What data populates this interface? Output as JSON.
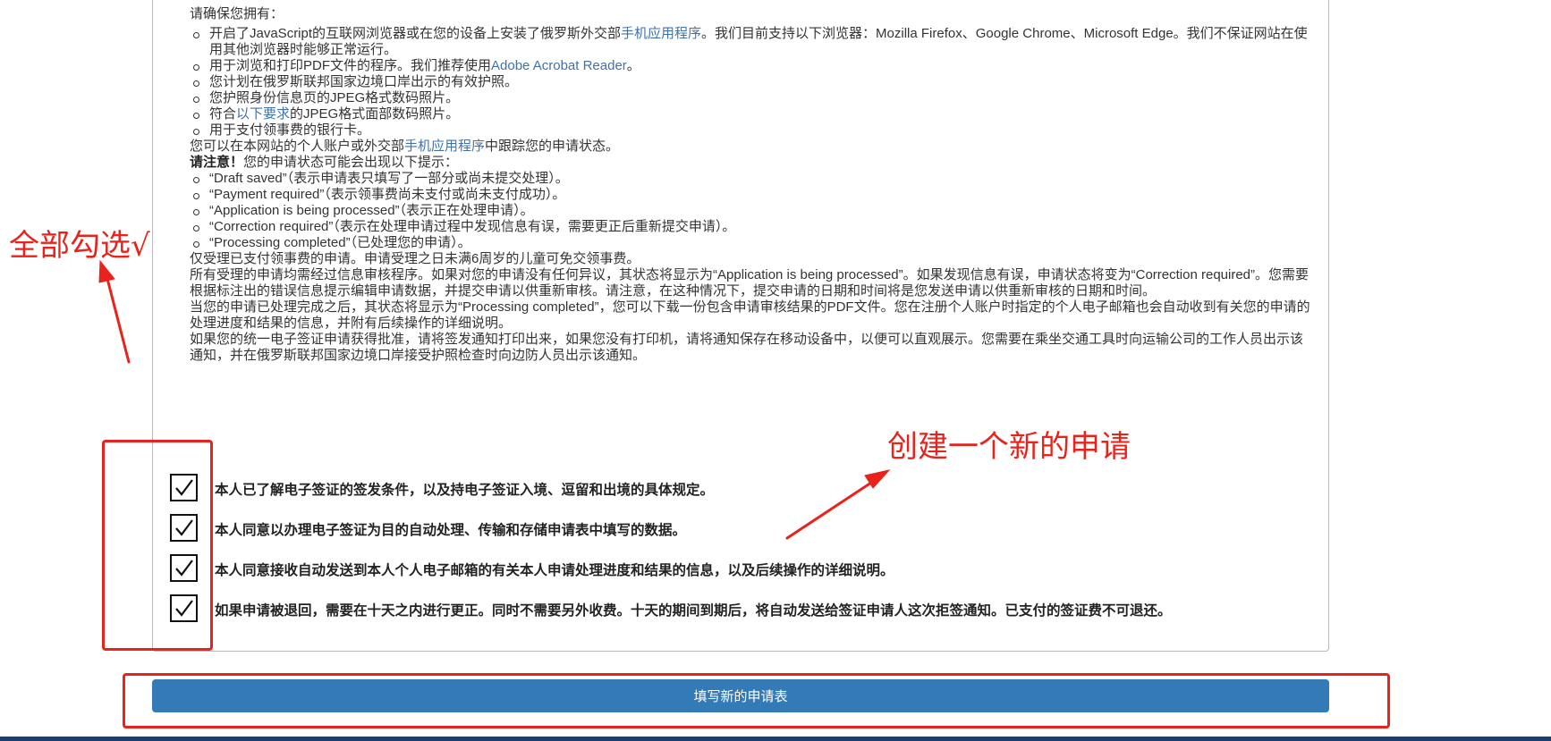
{
  "intro": {
    "heading": "请确保您拥有：",
    "bullets": [
      {
        "before": "开启了JavaScript的互联网浏览器或在您的设备上安装了俄罗斯外交部",
        "link": "手机应用程序",
        "after": "。我们目前支持以下浏览器：Mozilla Firefox、Google Chrome、Microsoft Edge。我们不保证网站在使用其他浏览器时能够正常运行。"
      },
      {
        "before": "用于浏览和打印PDF文件的程序。我们推荐使用",
        "link": "Adobe Acrobat Reader",
        "after": "。"
      },
      {
        "before": "您计划在俄罗斯联邦国家边境口岸出示的有效护照。",
        "link": "",
        "after": ""
      },
      {
        "before": "您护照身份信息页的JPEG格式数码照片。",
        "link": "",
        "after": ""
      },
      {
        "before": "符合",
        "link": "以下要求",
        "after": "的JPEG格式面部数码照片。"
      },
      {
        "before": "用于支付领事费的银行卡。",
        "link": "",
        "after": ""
      }
    ]
  },
  "tracking": {
    "before": "您可以在本网站的个人账户或外交部",
    "link": "手机应用程序",
    "after": "中跟踪您的申请状态。"
  },
  "notice": {
    "bold": "请注意！",
    "text": "您的申请状态可能会出现以下提示：",
    "statuses": [
      "“Draft saved”（表示申请表只填写了一部分或尚未提交处理）。",
      "“Payment required”（表示领事费尚未支付或尚未支付成功）。",
      "“Application is being processed”（表示正在处理申请）。",
      "“Correction required”（表示在处理申请过程中发现信息有误，需要更正后重新提交申请）。",
      "“Processing completed”（已处理您的申请）。"
    ]
  },
  "paragraphs": [
    "仅受理已支付领事费的申请。申请受理之日未满6周岁的儿童可免交领事费。",
    "所有受理的申请均需经过信息审核程序。如果对您的申请没有任何异议，其状态将显示为“Application is being processed”。如果发现信息有误，申请状态将变为“Correction required”。您需要根据标注出的错误信息提示编辑申请数据，并提交申请以供重新审核。请注意，在这种情况下，提交申请的日期和时间将是您发送申请以供重新审核的日期和时间。",
    "当您的申请已处理完成之后，其状态将显示为“Processing completed”，您可以下载一份包含申请审核结果的PDF文件。您在注册个人账户时指定的个人电子邮箱也会自动收到有关您的申请的处理进度和结果的信息，并附有后续操作的详细说明。",
    "如果您的统一电子签证申请获得批准，请将签发通知打印出来，如果您没有打印机，请将通知保存在移动设备中，以便可以直观展示。您需要在乘坐交通工具时向运输公司的工作人员出示该通知，并在俄罗斯联邦国家边境口岸接受护照检查时向边防人员出示该通知。"
  ],
  "checkboxes": [
    {
      "label": "本人已了解电子签证的签发条件，以及持电子签证入境、逗留和出境的具体规定。",
      "checked": true
    },
    {
      "label": "本人同意以办理电子签证为目的自动处理、传输和存储申请表中填写的数据。",
      "checked": true
    },
    {
      "label": "本人同意接收自动发送到本人个人电子邮箱的有关本人申请处理进度和结果的信息，以及后续操作的详细说明。",
      "checked": true
    },
    {
      "label": "如果申请被退回，需要在十天之内进行更正。同时不需要另外收费。十天的期间到期后，将自动发送给签证申请人这次拒签通知。已支付的签证费不可退还。",
      "checked": true
    }
  ],
  "submit": {
    "label": "填写新的申请表"
  },
  "annotations": {
    "select_all": "全部勾选√",
    "create_new": "创建一个新的申请",
    "color": "#e8231b"
  },
  "colors": {
    "link": "#3f72a8",
    "button": "#337ab7",
    "bottom_bar": "#1e3d6e"
  }
}
